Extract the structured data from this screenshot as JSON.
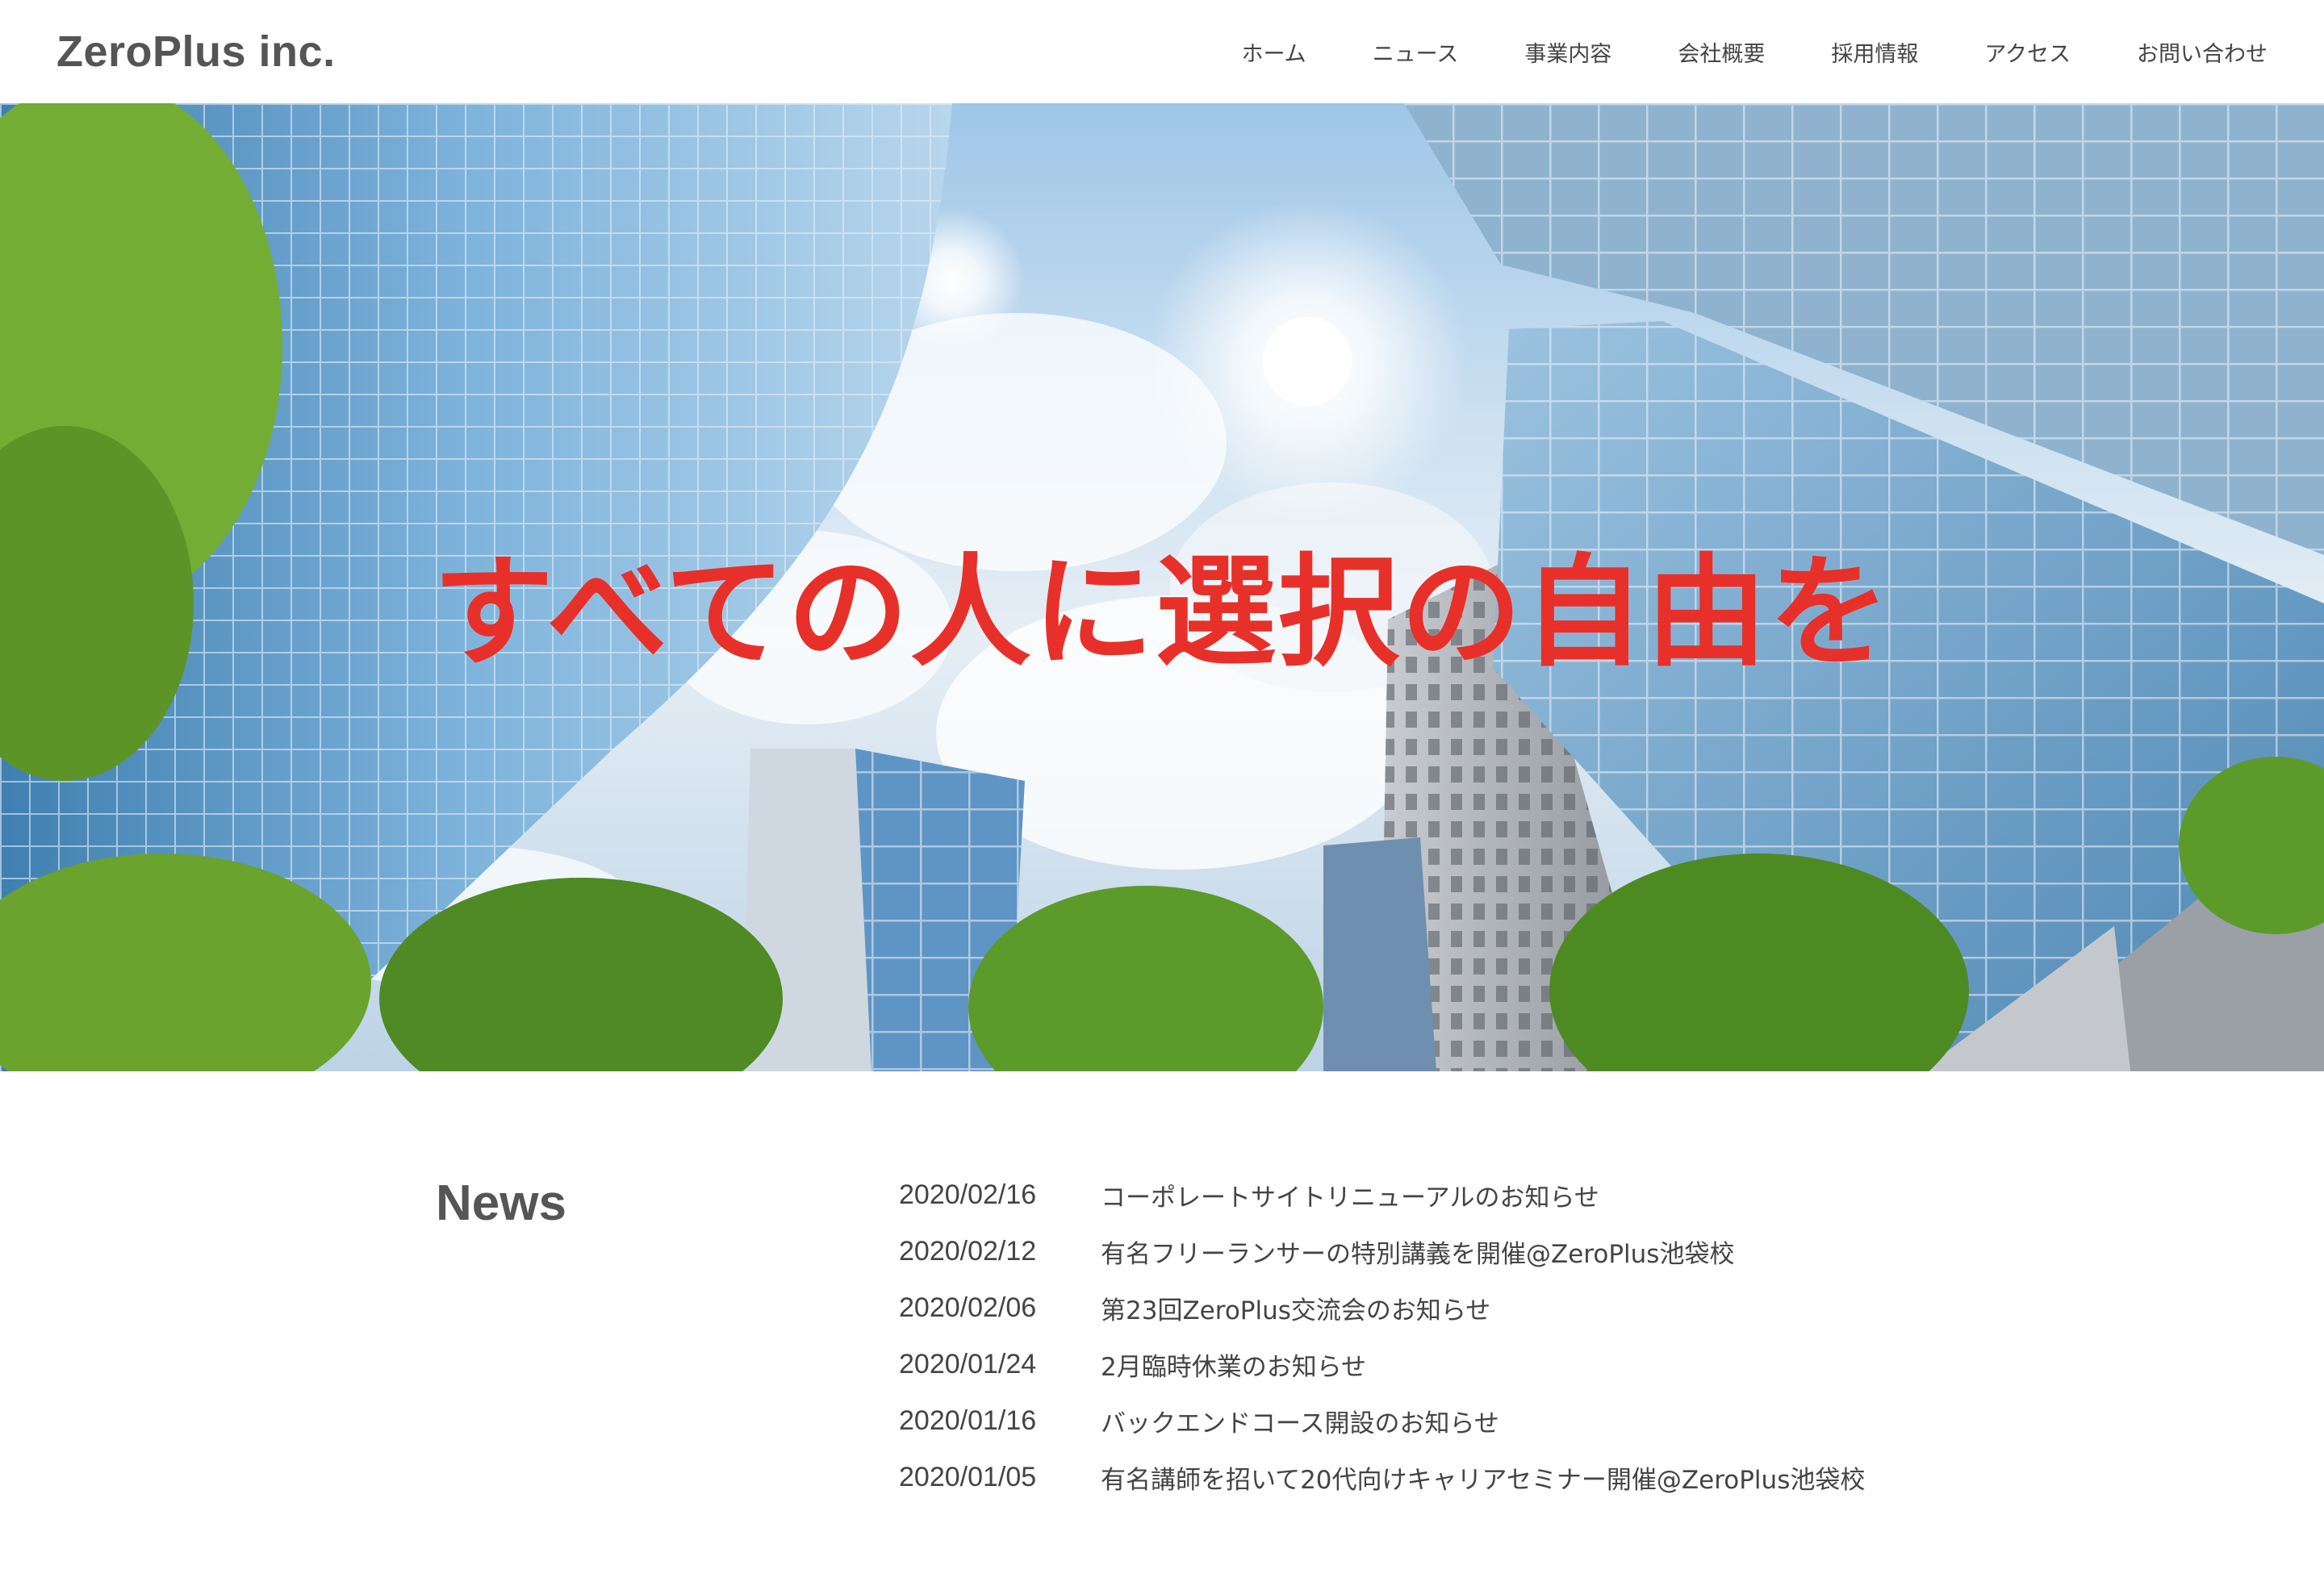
{
  "header": {
    "logo": "ZeroPlus inc.",
    "nav": [
      {
        "label": "ホーム"
      },
      {
        "label": "ニュース"
      },
      {
        "label": "事業内容"
      },
      {
        "label": "会社概要"
      },
      {
        "label": "採用情報"
      },
      {
        "label": "アクセス"
      },
      {
        "label": "お問い合わせ"
      }
    ]
  },
  "hero": {
    "headline": "すべての人に選択の自由を",
    "headline_color": "#e8302a"
  },
  "news": {
    "title": "News",
    "items": [
      {
        "date": "2020/02/16",
        "text": "コーポレートサイトリニューアルのお知らせ"
      },
      {
        "date": "2020/02/12",
        "text": "有名フリーランサーの特別講義を開催@ZeroPlus池袋校"
      },
      {
        "date": "2020/02/06",
        "text": "第23回ZeroPlus交流会のお知らせ"
      },
      {
        "date": "2020/01/24",
        "text": "2月臨時休業のお知らせ"
      },
      {
        "date": "2020/01/16",
        "text": "バックエンドコース開設のお知らせ"
      },
      {
        "date": "2020/01/05",
        "text": "有名講師を招いて20代向けキャリアセミナー開催@ZeroPlus池袋校"
      }
    ]
  }
}
